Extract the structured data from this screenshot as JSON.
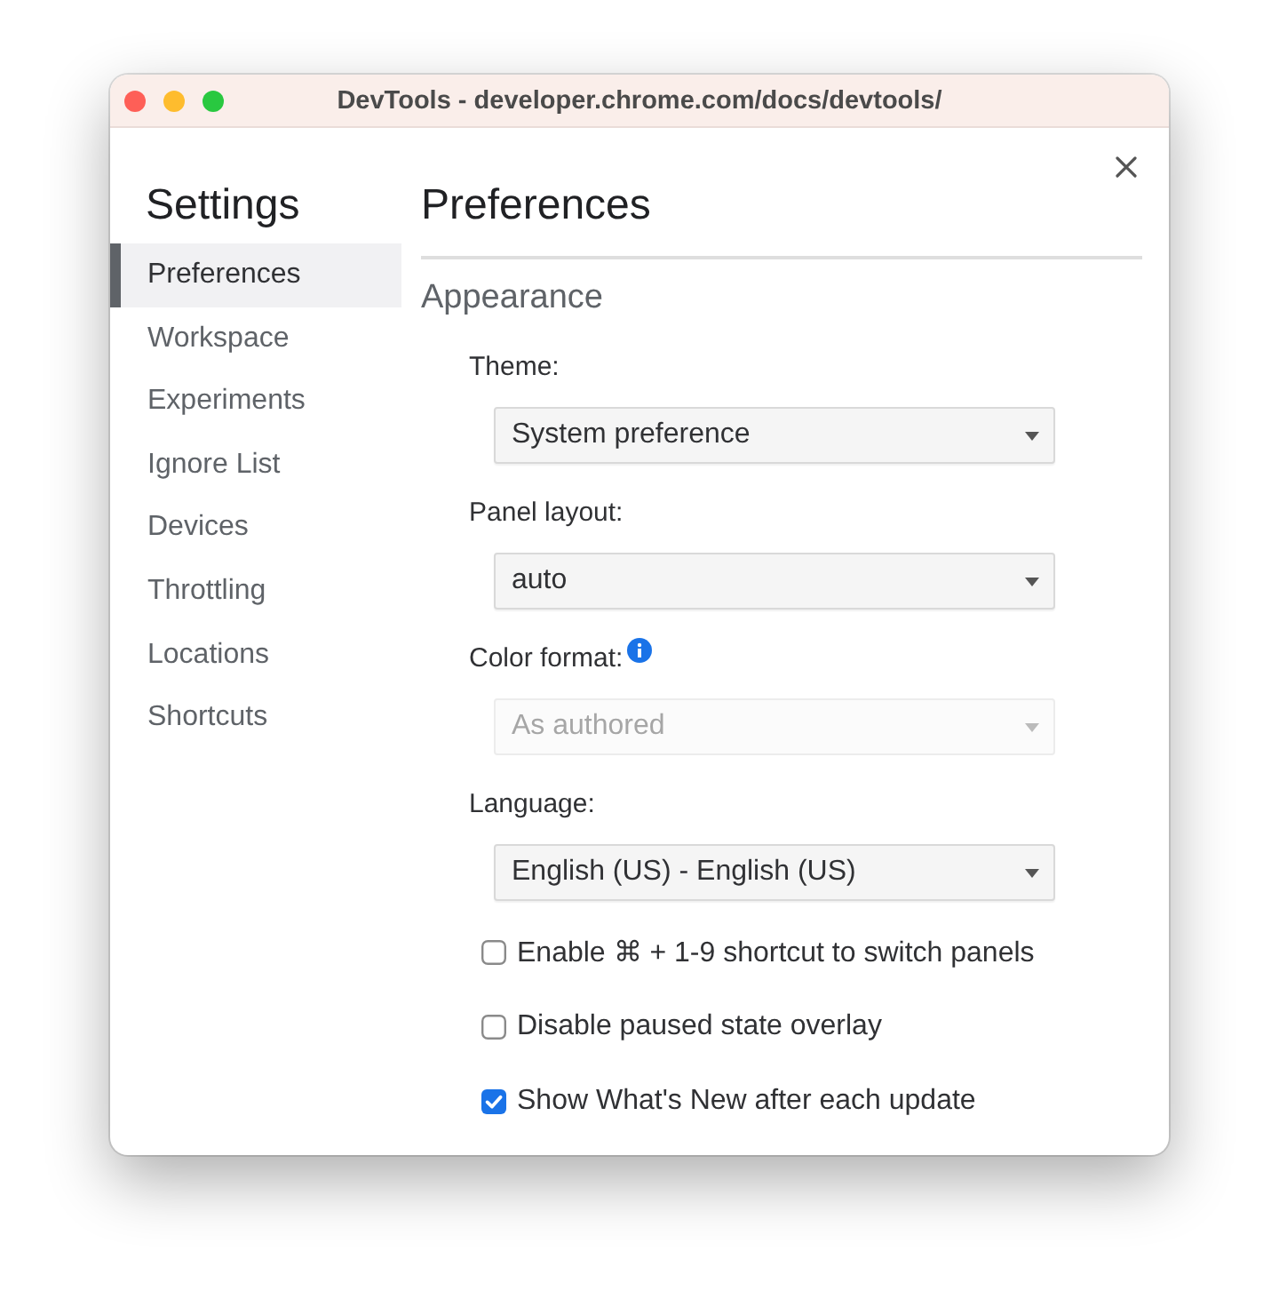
{
  "window": {
    "title": "DevTools - developer.chrome.com/docs/devtools/"
  },
  "sidebar": {
    "title": "Settings",
    "items": [
      {
        "label": "Preferences",
        "selected": true
      },
      {
        "label": "Workspace",
        "selected": false
      },
      {
        "label": "Experiments",
        "selected": false
      },
      {
        "label": "Ignore List",
        "selected": false
      },
      {
        "label": "Devices",
        "selected": false
      },
      {
        "label": "Throttling",
        "selected": false
      },
      {
        "label": "Locations",
        "selected": false
      },
      {
        "label": "Shortcuts",
        "selected": false
      }
    ]
  },
  "panel": {
    "title": "Preferences",
    "section": "Appearance",
    "settings": [
      {
        "kind": "select",
        "label": "Theme:",
        "value": "System preference",
        "disabled": false,
        "info": false
      },
      {
        "kind": "select",
        "label": "Panel layout:",
        "value": "auto",
        "disabled": false,
        "info": false
      },
      {
        "kind": "select",
        "label": "Color format:",
        "value": "As authored",
        "disabled": true,
        "info": true
      },
      {
        "kind": "select",
        "label": "Language:",
        "value": "English (US) - English (US)",
        "disabled": false,
        "info": false
      },
      {
        "kind": "checkbox",
        "label": "Enable ⌘ + 1-9 shortcut to switch panels",
        "checked": false
      },
      {
        "kind": "checkbox",
        "label": "Disable paused state overlay",
        "checked": false
      },
      {
        "kind": "checkbox",
        "label": "Show What's New after each update",
        "checked": true
      }
    ]
  }
}
